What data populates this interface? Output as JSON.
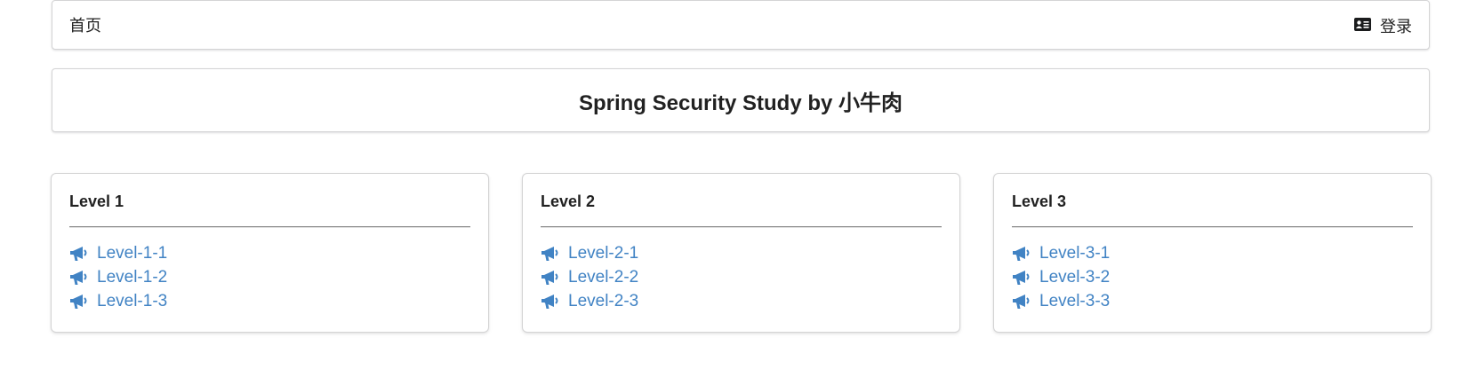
{
  "menu": {
    "home_label": "首页",
    "login_label": "登录",
    "login_icon": "id-card-icon"
  },
  "title": "Spring Security Study by 小牛肉",
  "link_color": "#4183c4",
  "levels": [
    {
      "heading": "Level 1",
      "links": [
        {
          "label": "Level-1-1",
          "icon": "bullhorn-icon"
        },
        {
          "label": "Level-1-2",
          "icon": "bullhorn-icon"
        },
        {
          "label": "Level-1-3",
          "icon": "bullhorn-icon"
        }
      ]
    },
    {
      "heading": "Level 2",
      "links": [
        {
          "label": "Level-2-1",
          "icon": "bullhorn-icon"
        },
        {
          "label": "Level-2-2",
          "icon": "bullhorn-icon"
        },
        {
          "label": "Level-2-3",
          "icon": "bullhorn-icon"
        }
      ]
    },
    {
      "heading": "Level 3",
      "links": [
        {
          "label": "Level-3-1",
          "icon": "bullhorn-icon"
        },
        {
          "label": "Level-3-2",
          "icon": "bullhorn-icon"
        },
        {
          "label": "Level-3-3",
          "icon": "bullhorn-icon"
        }
      ]
    }
  ]
}
